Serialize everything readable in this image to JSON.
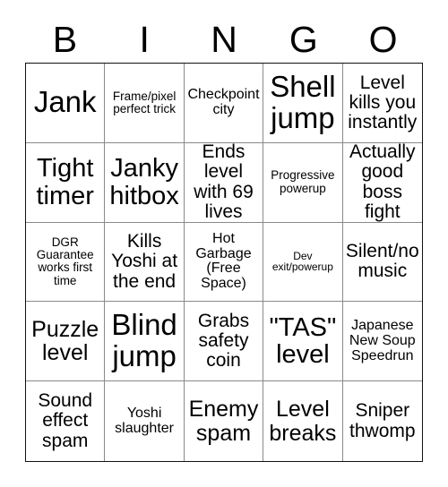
{
  "title": "BINGO",
  "header": {
    "letters": [
      "B",
      "I",
      "N",
      "G",
      "O"
    ]
  },
  "grid": {
    "rows": 5,
    "columns": 5,
    "border_color": "#111111",
    "gridline_color": "#8a8a8a",
    "background_color": "#ffffff",
    "text_color": "#000000",
    "free_space_index": 12
  },
  "cells": [
    {
      "text": "Jank",
      "size": "xxl"
    },
    {
      "text": "Frame/pixel perfect trick",
      "size": "xs"
    },
    {
      "text": "Checkpoint city",
      "size": "sm"
    },
    {
      "text": "Shell jump",
      "size": "xxl"
    },
    {
      "text": "Level kills you instantly",
      "size": "md"
    },
    {
      "text": "Tight timer",
      "size": "xl"
    },
    {
      "text": "Janky hitbox",
      "size": "xl"
    },
    {
      "text": "Ends level with 69 lives",
      "size": "md"
    },
    {
      "text": "Progressive powerup",
      "size": "xs"
    },
    {
      "text": "Actually good boss fight",
      "size": "md"
    },
    {
      "text": "DGR Guarantee works first time",
      "size": "xs"
    },
    {
      "text": "Kills Yoshi at the end",
      "size": "md"
    },
    {
      "text": "Hot Garbage (Free Space)",
      "size": "sm"
    },
    {
      "text": "Dev exit/powerup",
      "size": "xxs"
    },
    {
      "text": "Silent/no music",
      "size": "md"
    },
    {
      "text": "Puzzle level",
      "size": "lg"
    },
    {
      "text": "Blind jump",
      "size": "xxl"
    },
    {
      "text": "Grabs safety coin",
      "size": "md"
    },
    {
      "text": "\"TAS\" level",
      "size": "xl"
    },
    {
      "text": "Japanese New Soup Speedrun",
      "size": "sm"
    },
    {
      "text": "Sound effect spam",
      "size": "md"
    },
    {
      "text": "Yoshi slaughter",
      "size": "sm"
    },
    {
      "text": "Enemy spam",
      "size": "lg"
    },
    {
      "text": "Level breaks",
      "size": "lg"
    },
    {
      "text": "Sniper thwomp",
      "size": "md"
    }
  ]
}
